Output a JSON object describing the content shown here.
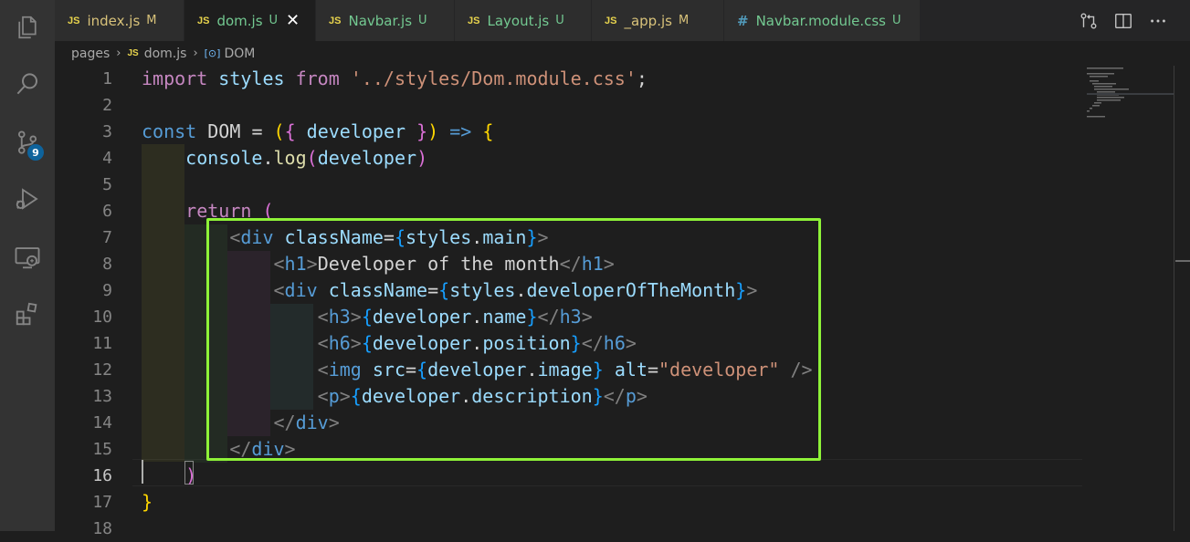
{
  "activity_bar": {
    "items": [
      "explorer-icon",
      "search-icon",
      "source-control-icon",
      "run-debug-icon",
      "remote-explorer-icon",
      "extensions-icon"
    ],
    "source_control_badge": "9"
  },
  "tabs": [
    {
      "icon": "JS",
      "name": "index.js",
      "status": "M"
    },
    {
      "icon": "JS",
      "name": "dom.js",
      "status": "U"
    },
    {
      "icon": "JS",
      "name": "Navbar.js",
      "status": "U"
    },
    {
      "icon": "JS",
      "name": "Layout.js",
      "status": "U"
    },
    {
      "icon": "JS",
      "name": "_app.js",
      "status": "M"
    },
    {
      "icon": "#",
      "name": "Navbar.module.css",
      "status": "U"
    }
  ],
  "breadcrumb": {
    "folder": "pages",
    "file_icon": "JS",
    "file": "dom.js",
    "symbol_icon": "[⊙]",
    "symbol": "DOM"
  },
  "editor": {
    "active_line": "16",
    "line_numbers": [
      "1",
      "2",
      "3",
      "4",
      "5",
      "6",
      "7",
      "8",
      "9",
      "10",
      "11",
      "12",
      "13",
      "14",
      "15",
      "16",
      "17",
      "18"
    ],
    "lines": [
      [
        [
          "kw2",
          "import"
        ],
        [
          "txt",
          " "
        ],
        [
          "var",
          "styles"
        ],
        [
          "txt",
          " "
        ],
        [
          "kw2",
          "from"
        ],
        [
          "txt",
          " "
        ],
        [
          "str",
          "'../styles/Dom.module.css'"
        ],
        [
          "txt",
          ";"
        ]
      ],
      [],
      [
        [
          "kw",
          "const"
        ],
        [
          "txt",
          " DOM "
        ],
        [
          "txt",
          "="
        ],
        [
          "txt",
          " "
        ],
        [
          "b1",
          "("
        ],
        [
          "b2",
          "{"
        ],
        [
          "txt",
          " "
        ],
        [
          "var",
          "developer"
        ],
        [
          "txt",
          " "
        ],
        [
          "b2",
          "}"
        ],
        [
          "b1",
          ")"
        ],
        [
          "txt",
          " "
        ],
        [
          "kw",
          "=>"
        ],
        [
          "txt",
          " "
        ],
        [
          "b1",
          "{"
        ]
      ],
      [
        [
          "txt",
          "    "
        ],
        [
          "var",
          "console"
        ],
        [
          "txt",
          "."
        ],
        [
          "fn",
          "log"
        ],
        [
          "b2",
          "("
        ],
        [
          "var",
          "developer"
        ],
        [
          "b2",
          ")"
        ]
      ],
      [],
      [
        [
          "txt",
          "    "
        ],
        [
          "kw2",
          "return"
        ],
        [
          "txt",
          " "
        ],
        [
          "b2",
          "("
        ]
      ],
      [
        [
          "txt",
          "        "
        ],
        [
          "brk",
          "<"
        ],
        [
          "tag",
          "div"
        ],
        [
          "txt",
          " "
        ],
        [
          "var",
          "className"
        ],
        [
          "txt",
          "="
        ],
        [
          "b3",
          "{"
        ],
        [
          "var",
          "styles"
        ],
        [
          "txt",
          "."
        ],
        [
          "var",
          "main"
        ],
        [
          "b3",
          "}"
        ],
        [
          "brk",
          ">"
        ]
      ],
      [
        [
          "txt",
          "            "
        ],
        [
          "brk",
          "<"
        ],
        [
          "tag",
          "h1"
        ],
        [
          "brk",
          ">"
        ],
        [
          "txt",
          "Developer of the month"
        ],
        [
          "brk",
          "</"
        ],
        [
          "tag",
          "h1"
        ],
        [
          "brk",
          ">"
        ]
      ],
      [
        [
          "txt",
          "            "
        ],
        [
          "brk",
          "<"
        ],
        [
          "tag",
          "div"
        ],
        [
          "txt",
          " "
        ],
        [
          "var",
          "className"
        ],
        [
          "txt",
          "="
        ],
        [
          "b3",
          "{"
        ],
        [
          "var",
          "styles"
        ],
        [
          "txt",
          "."
        ],
        [
          "var",
          "developerOfTheMonth"
        ],
        [
          "b3",
          "}"
        ],
        [
          "brk",
          ">"
        ]
      ],
      [
        [
          "txt",
          "                "
        ],
        [
          "brk",
          "<"
        ],
        [
          "tag",
          "h3"
        ],
        [
          "brk",
          ">"
        ],
        [
          "b3",
          "{"
        ],
        [
          "var",
          "developer"
        ],
        [
          "txt",
          "."
        ],
        [
          "var",
          "name"
        ],
        [
          "b3",
          "}"
        ],
        [
          "brk",
          "</"
        ],
        [
          "tag",
          "h3"
        ],
        [
          "brk",
          ">"
        ]
      ],
      [
        [
          "txt",
          "                "
        ],
        [
          "brk",
          "<"
        ],
        [
          "tag",
          "h6"
        ],
        [
          "brk",
          ">"
        ],
        [
          "b3",
          "{"
        ],
        [
          "var",
          "developer"
        ],
        [
          "txt",
          "."
        ],
        [
          "var",
          "position"
        ],
        [
          "b3",
          "}"
        ],
        [
          "brk",
          "</"
        ],
        [
          "tag",
          "h6"
        ],
        [
          "brk",
          ">"
        ]
      ],
      [
        [
          "txt",
          "                "
        ],
        [
          "brk",
          "<"
        ],
        [
          "tag",
          "img"
        ],
        [
          "txt",
          " "
        ],
        [
          "var",
          "src"
        ],
        [
          "txt",
          "="
        ],
        [
          "b3",
          "{"
        ],
        [
          "var",
          "developer"
        ],
        [
          "txt",
          "."
        ],
        [
          "var",
          "image"
        ],
        [
          "b3",
          "}"
        ],
        [
          "txt",
          " "
        ],
        [
          "var",
          "alt"
        ],
        [
          "txt",
          "="
        ],
        [
          "str",
          "\"developer\""
        ],
        [
          "txt",
          " "
        ],
        [
          "brk",
          "/>"
        ]
      ],
      [
        [
          "txt",
          "                "
        ],
        [
          "brk",
          "<"
        ],
        [
          "tag",
          "p"
        ],
        [
          "brk",
          ">"
        ],
        [
          "b3",
          "{"
        ],
        [
          "var",
          "developer"
        ],
        [
          "txt",
          "."
        ],
        [
          "var",
          "description"
        ],
        [
          "b3",
          "}"
        ],
        [
          "brk",
          "</"
        ],
        [
          "tag",
          "p"
        ],
        [
          "brk",
          ">"
        ]
      ],
      [
        [
          "txt",
          "            "
        ],
        [
          "brk",
          "</"
        ],
        [
          "tag",
          "div"
        ],
        [
          "brk",
          ">"
        ]
      ],
      [
        [
          "txt",
          "        "
        ],
        [
          "brk",
          "</"
        ],
        [
          "tag",
          "div"
        ],
        [
          "brk",
          ">"
        ]
      ],
      [
        [
          "txt",
          "    "
        ],
        [
          "b2",
          ")"
        ]
      ],
      [
        [
          "b1",
          "}"
        ]
      ],
      []
    ]
  },
  "colors": {
    "highlight_border": "#8ef238",
    "badge_bg": "#0e639c",
    "modified_status": "#d8c27a",
    "untracked_status": "#73c991"
  }
}
